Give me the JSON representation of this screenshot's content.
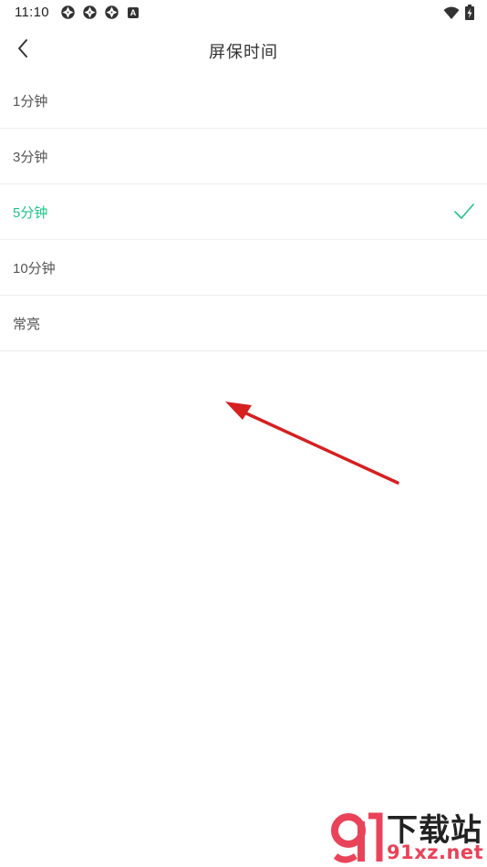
{
  "status_bar": {
    "time": "11:10",
    "notification_icons": [
      "aperture-icon",
      "aperture-icon",
      "aperture-icon"
    ],
    "badge_letter": "A",
    "right_icons": [
      "wifi-icon",
      "battery-charging-icon"
    ]
  },
  "header": {
    "title": "屏保时间",
    "back_icon": "chevron-left-icon"
  },
  "options": [
    {
      "label": "1分钟",
      "selected": false
    },
    {
      "label": "3分钟",
      "selected": false
    },
    {
      "label": "5分钟",
      "selected": true
    },
    {
      "label": "10分钟",
      "selected": false
    },
    {
      "label": "常亮",
      "selected": false
    }
  ],
  "colors": {
    "accent": "#1fc48a",
    "annotation_arrow": "#d62020",
    "watermark_red": "#e94359"
  },
  "watermark": {
    "title": "下载站",
    "url": "91xz.net"
  }
}
